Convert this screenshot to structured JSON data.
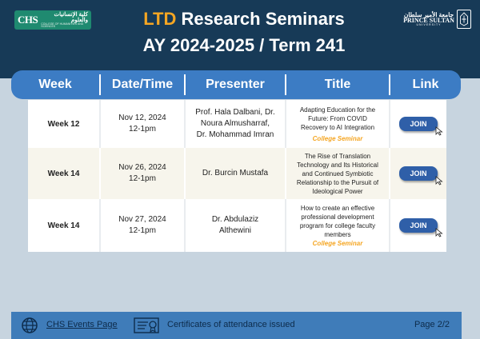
{
  "header": {
    "logo_left": {
      "mark": "CHS",
      "arabic": "كلية الإنسانيات والعلوم",
      "english": "COLLEGE OF HUMANITIES AND SCIENCES"
    },
    "title_accent": "LTD",
    "title_rest": "Research Seminars",
    "subtitle": "AY 2024-2025 / Term 241",
    "logo_right": {
      "arabic": "جامعة الأمير سلطان",
      "english": "PRINCE SULTAN",
      "univ": "UNIVERSITY"
    }
  },
  "table": {
    "columns": [
      "Week",
      "Date/Time",
      "Presenter",
      "Title",
      "Link"
    ],
    "rows": [
      {
        "week": "Week 12",
        "date": "Nov 12, 2024",
        "time": "12-1pm",
        "presenter": [
          "Prof. Hala Dalbani, Dr.",
          "Noura Almusharraf,",
          "Dr. Mohammad Imran"
        ],
        "title": [
          "Adapting Education for the",
          "Future: From COVID",
          "Recovery to AI Integration"
        ],
        "tag": "College Seminar",
        "link": "JOIN"
      },
      {
        "week": "Week 14",
        "date": "Nov 26, 2024",
        "time": "12-1pm",
        "presenter": [
          "Dr. Burcin Mustafa"
        ],
        "title": [
          "The Rise of Translation",
          "Technology and Its Historical",
          "and Continued Symbiotic",
          "Relationship to the Pursuit of",
          "Ideological Power"
        ],
        "tag": "",
        "link": "JOIN"
      },
      {
        "week": "Week 14",
        "date": "Nov 27, 2024",
        "time": "12-1pm",
        "presenter": [
          "Dr. Abdulaziz",
          "Althewini"
        ],
        "title": [
          "How to create an effective",
          "professional development",
          "program for college faculty",
          "members"
        ],
        "tag": "College Seminar",
        "link": "JOIN"
      }
    ]
  },
  "footer": {
    "events_link": "CHS Events Page",
    "certificates": "Certificates of attendance issued",
    "page": "Page 2/2"
  },
  "icons": [
    "globe-icon",
    "certificate-icon",
    "cursor-icon"
  ],
  "colors": {
    "navy": "#173a57",
    "accent": "#f5a623",
    "header_blue": "#3c7cc4",
    "join_blue": "#2f5fa8",
    "background": "#c7d4df"
  }
}
